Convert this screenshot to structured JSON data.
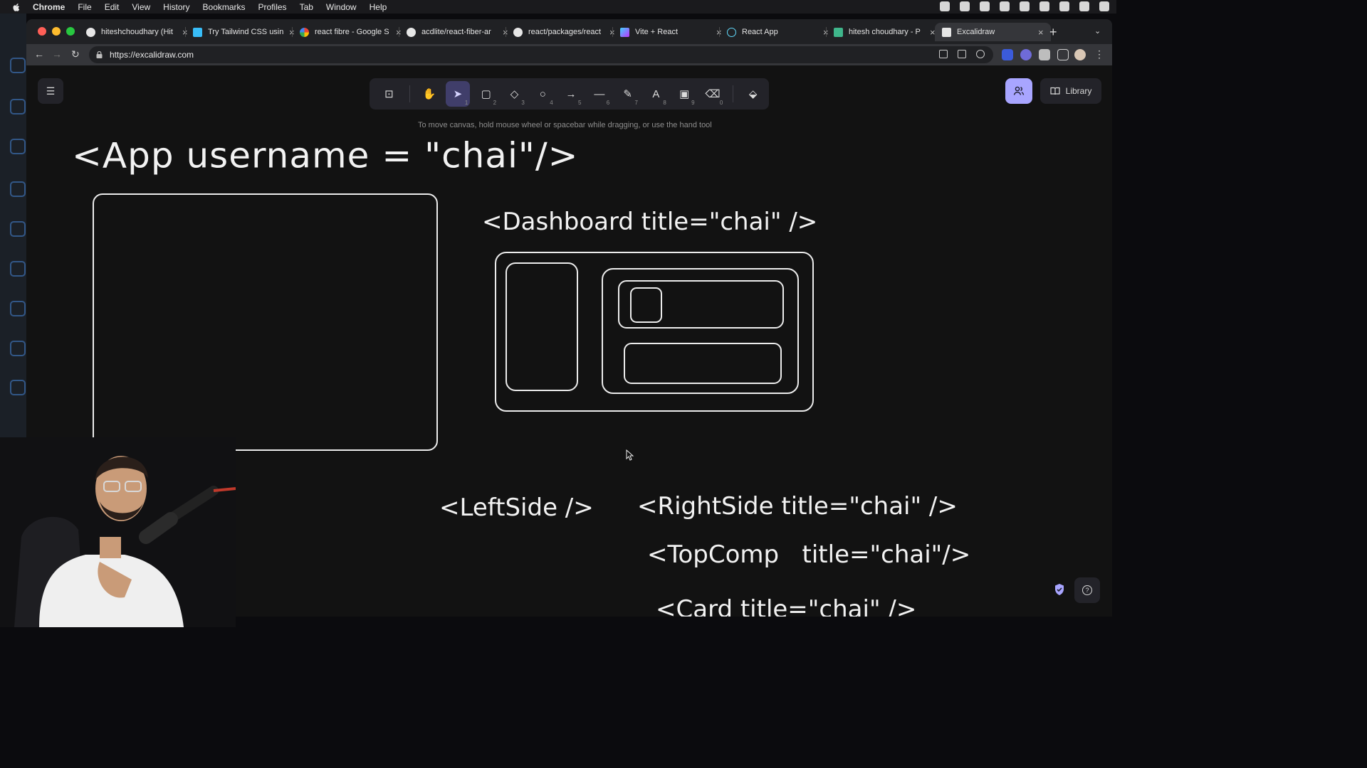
{
  "menubar": {
    "app": "Chrome",
    "items": [
      "File",
      "Edit",
      "View",
      "History",
      "Bookmarks",
      "Profiles",
      "Tab",
      "Window",
      "Help"
    ]
  },
  "tabs": [
    {
      "label": "hiteshchoudhary (Hit",
      "icon": "github-icon"
    },
    {
      "label": "Try Tailwind CSS usin",
      "icon": "tailwind-icon"
    },
    {
      "label": "react fibre - Google S",
      "icon": "google-icon"
    },
    {
      "label": "acdlite/react-fiber-ar",
      "icon": "github-icon"
    },
    {
      "label": "react/packages/react",
      "icon": "github-icon"
    },
    {
      "label": "Vite + React",
      "icon": "vite-icon"
    },
    {
      "label": "React App",
      "icon": "react-icon"
    },
    {
      "label": "hitesh choudhary - P",
      "icon": "page-icon"
    },
    {
      "label": "Excalidraw",
      "icon": "excalidraw-icon",
      "active": true
    }
  ],
  "omnibox": {
    "url": "https://excalidraw.com"
  },
  "excalidraw": {
    "tools": [
      {
        "name": "lock",
        "glyph": "🔓",
        "key": ""
      },
      {
        "name": "hand",
        "glyph": "✋",
        "key": ""
      },
      {
        "name": "selection",
        "glyph": "➤",
        "key": "1",
        "selected": true
      },
      {
        "name": "rectangle",
        "glyph": "▢",
        "key": "2"
      },
      {
        "name": "diamond",
        "glyph": "◇",
        "key": "3"
      },
      {
        "name": "ellipse",
        "glyph": "○",
        "key": "4"
      },
      {
        "name": "arrow",
        "glyph": "→",
        "key": "5"
      },
      {
        "name": "line",
        "glyph": "—",
        "key": "6"
      },
      {
        "name": "draw",
        "glyph": "✎",
        "key": "7"
      },
      {
        "name": "text",
        "glyph": "A",
        "key": "8"
      },
      {
        "name": "image",
        "glyph": "🖼",
        "key": "9"
      },
      {
        "name": "eraser",
        "glyph": "⌫",
        "key": "0"
      },
      {
        "name": "extra-tools",
        "glyph": "⬙",
        "key": ""
      }
    ],
    "hint": "To move canvas, hold mouse wheel or spacebar while dragging, or use the hand tool",
    "library_label": "Library",
    "help_label": "?"
  },
  "drawing": {
    "app_text": "<App username = \"chai\"/>",
    "dashboard_text": "<Dashboard title=\"chai\" />",
    "leftside_text": "<LeftSide />",
    "rightside_text": "<RightSide title=\"chai\" />",
    "topcomp_text": "<TopComp   title=\"chai\"/>",
    "card_text": "<Card title=\"chai\" />"
  },
  "colors": {
    "accent": "#a8a5ff",
    "selected_tool": "#403e6a",
    "stroke": "#ececec",
    "canvas_bg": "#121212"
  }
}
